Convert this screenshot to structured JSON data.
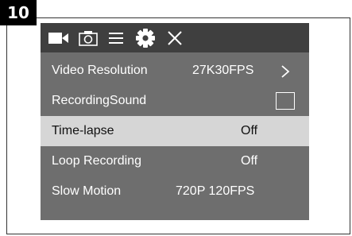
{
  "step_badge": "10",
  "tabs": [
    {
      "icon": "video-camera-icon",
      "active": true
    },
    {
      "icon": "photo-camera-icon",
      "active": false
    },
    {
      "icon": "menu-icon",
      "active": false
    },
    {
      "icon": "gear-icon",
      "active": false
    },
    {
      "icon": "close-icon",
      "active": false
    }
  ],
  "menu": [
    {
      "label": "Video Resolution",
      "value": "27K30FPS",
      "control": "chevron-right-icon"
    },
    {
      "label": "RecordingSound",
      "value": "",
      "control": "checkbox",
      "checked": false
    },
    {
      "label": "Time-lapse",
      "value": "Off",
      "selected": true
    },
    {
      "label": "Loop Recording",
      "value": "Off"
    },
    {
      "label": "Slow Motion",
      "value": "720P 120FPS"
    }
  ],
  "colors": {
    "tab_bar": "#3f3f3f",
    "menu_bg": "#6e6e6e",
    "selected_row": "#d6d6d6",
    "active_icon": "#ffffff"
  }
}
